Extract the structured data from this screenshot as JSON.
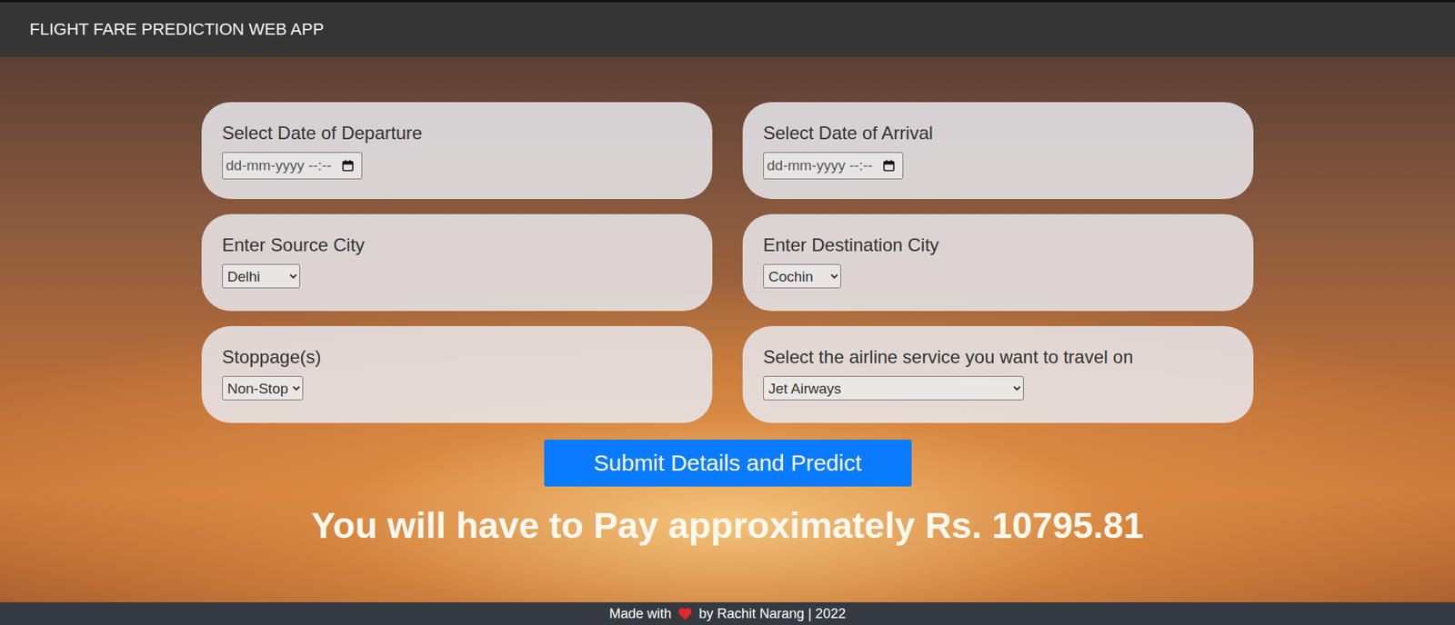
{
  "navbar": {
    "title": "FLIGHT FARE PREDICTION WEB APP"
  },
  "fields": [
    {
      "label": "Select Date of Departure",
      "kind": "datetime",
      "value": "dd-mm-yyyy --:--"
    },
    {
      "label": "Select Date of Arrival",
      "kind": "datetime",
      "value": "dd-mm-yyyy --:--"
    },
    {
      "label": "Enter Source City",
      "kind": "select",
      "value": "Delhi"
    },
    {
      "label": "Enter Destination City",
      "kind": "select",
      "value": "Cochin"
    },
    {
      "label": "Stoppage(s)",
      "kind": "select",
      "value": "Non-Stop"
    },
    {
      "label": "Select the airline service you want to travel on",
      "kind": "select",
      "value": "Jet Airways"
    }
  ],
  "submit": {
    "label": "Submit Details and Predict"
  },
  "result": "You will have to Pay approximately Rs. 10795.81",
  "footer": {
    "before": "Made with",
    "after": "by Rachit Narang | 2022"
  }
}
